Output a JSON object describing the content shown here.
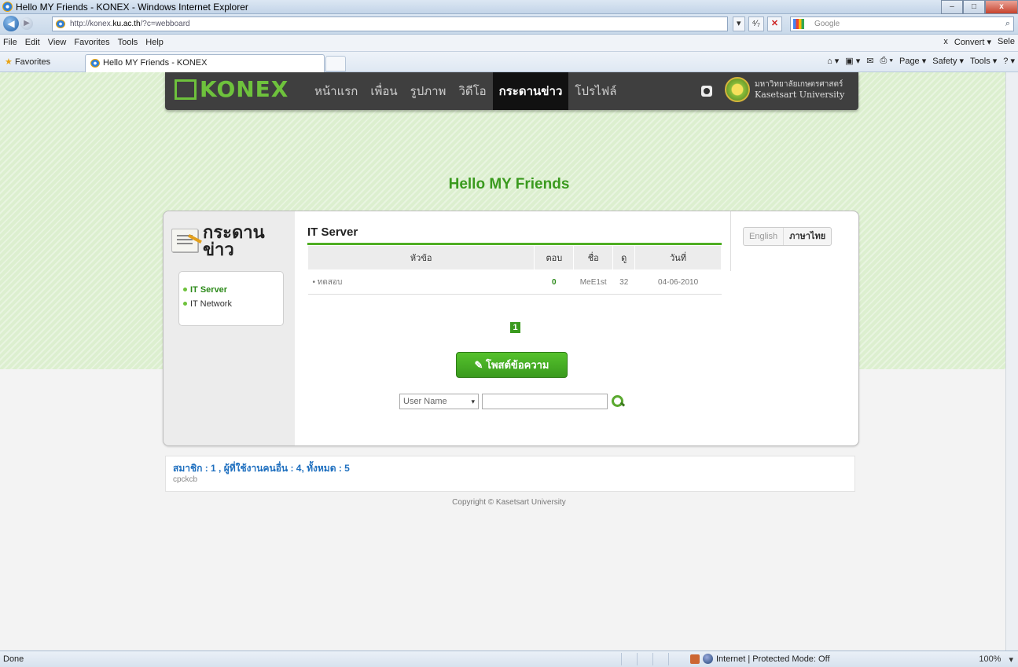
{
  "window": {
    "title": "Hello MY Friends - KONEX - Windows Internet Explorer",
    "minimize": "–",
    "maximize": "□",
    "close": "x"
  },
  "address": {
    "url_prefix": "http://konex.",
    "url_host": "ku.ac.th",
    "url_suffix": "/?c=webboard",
    "dropdown": "▾",
    "refresh": "⁴⁄₇",
    "stop": "✕",
    "search_placeholder": "Google",
    "search_icon": "⌕"
  },
  "menubar": {
    "items": [
      "File",
      "Edit",
      "View",
      "Favorites",
      "Tools",
      "Help"
    ],
    "right": [
      "x",
      "Convert ▾",
      "Sele"
    ]
  },
  "favorites": {
    "label": "Favorites",
    "tab_title": "Hello MY Friends - KONEX",
    "commands": [
      "⌂ ▾",
      "▣ ▾",
      "✉",
      "⎙ ▾",
      "Page ▾",
      "Safety ▾",
      "Tools ▾",
      "? ▾"
    ]
  },
  "site": {
    "logo_text": "KONEX",
    "nav": [
      "หน้าแรก",
      "เพื่อน",
      "รูปภาพ",
      "วิดีโอ",
      "กระดานข่าว",
      "โปรไฟล์"
    ],
    "active_nav_index": 4,
    "university_th": "มหาวิทยาลัยเกษตรศาสตร์",
    "university_en": "Kasetsart University",
    "page_title": "Hello MY Friends"
  },
  "board": {
    "title": "กระดานข่าว",
    "categories": [
      "IT Server",
      "IT Network"
    ],
    "forum_title": "IT Server",
    "columns": [
      "หัวข้อ",
      "ตอบ",
      "ชื่อ",
      "ดู",
      "วันที่"
    ],
    "rows": [
      {
        "topic": "• ทดสอบ",
        "replies": "0",
        "author": "MeE1st",
        "views": "32",
        "date": "04-06-2010"
      }
    ],
    "page_number": "1",
    "post_button": "โพสต์ข้อความ",
    "search_field": "User Name",
    "select_arrow": "▾"
  },
  "language": {
    "english": "English",
    "thai": "ภาษาไทย"
  },
  "footer": {
    "stats": "สมาชิก : 1 , ผู้ที่ใช้งานคนอื่น : 4, ทั้งหมด : 5",
    "online_user": "cpckcb",
    "copyright": "Copyright © Kasetsart University"
  },
  "statusbar": {
    "text": "Done",
    "zone": "Internet | Protected Mode: Off",
    "zoom": "100%",
    "zoom_arrow": "▾"
  },
  "colors": {
    "brand_green": "#3a9a1e",
    "nav_dark": "#3f3f3f",
    "link_blue": "#1e6fbf"
  }
}
